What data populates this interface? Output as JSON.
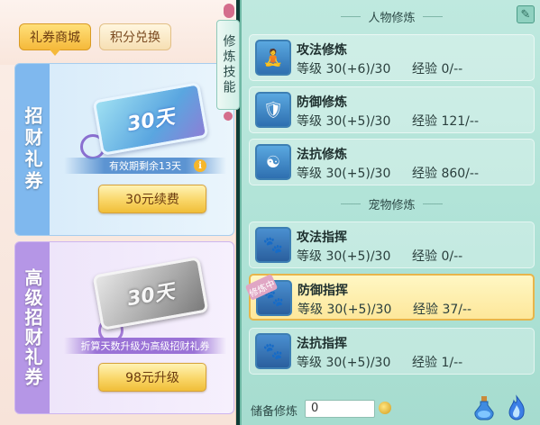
{
  "shop": {
    "tabs": [
      {
        "label": "礼券商城",
        "active": true
      },
      {
        "label": "积分兑换",
        "active": false
      }
    ],
    "cards": [
      {
        "title": "招财礼券",
        "ticket_text": "30天",
        "strip": "有效期剩余13天",
        "button": "30元续费"
      },
      {
        "title": "高级招财礼券",
        "ticket_text": "30天",
        "strip": "折算天数升级为高级招财礼券",
        "button": "98元升级"
      }
    ]
  },
  "cultivation_tab": "修炼技能",
  "sections": {
    "character": "人物修炼",
    "pet": "宠物修炼"
  },
  "labels": {
    "level": "等级",
    "exp": "经验"
  },
  "character_skills": [
    {
      "name": "攻法修炼",
      "level": "30(+6)/30",
      "exp": "0/--",
      "icon": "meditating-figure-icon"
    },
    {
      "name": "防御修炼",
      "level": "30(+5)/30",
      "exp": "121/--",
      "icon": "shield-icon"
    },
    {
      "name": "法抗修炼",
      "level": "30(+5)/30",
      "exp": "860/--",
      "icon": "magic-shield-icon"
    }
  ],
  "pet_skills": [
    {
      "name": "攻法指挥",
      "level": "30(+5)/30",
      "exp": "0/--",
      "icon": "paw-attack-icon"
    },
    {
      "name": "防御指挥",
      "level": "30(+5)/30",
      "exp": "37/--",
      "icon": "paw-defense-icon",
      "badge": "修炼中",
      "selected": true
    },
    {
      "name": "法抗指挥",
      "level": "30(+5)/30",
      "exp": "1/--",
      "icon": "paw-resist-icon"
    }
  ],
  "reserve": {
    "label": "储备修炼",
    "value": "0"
  },
  "colors": {
    "accent": "#f5b93a",
    "panel": "#aee2d6",
    "selected_row": "#fde79a"
  }
}
